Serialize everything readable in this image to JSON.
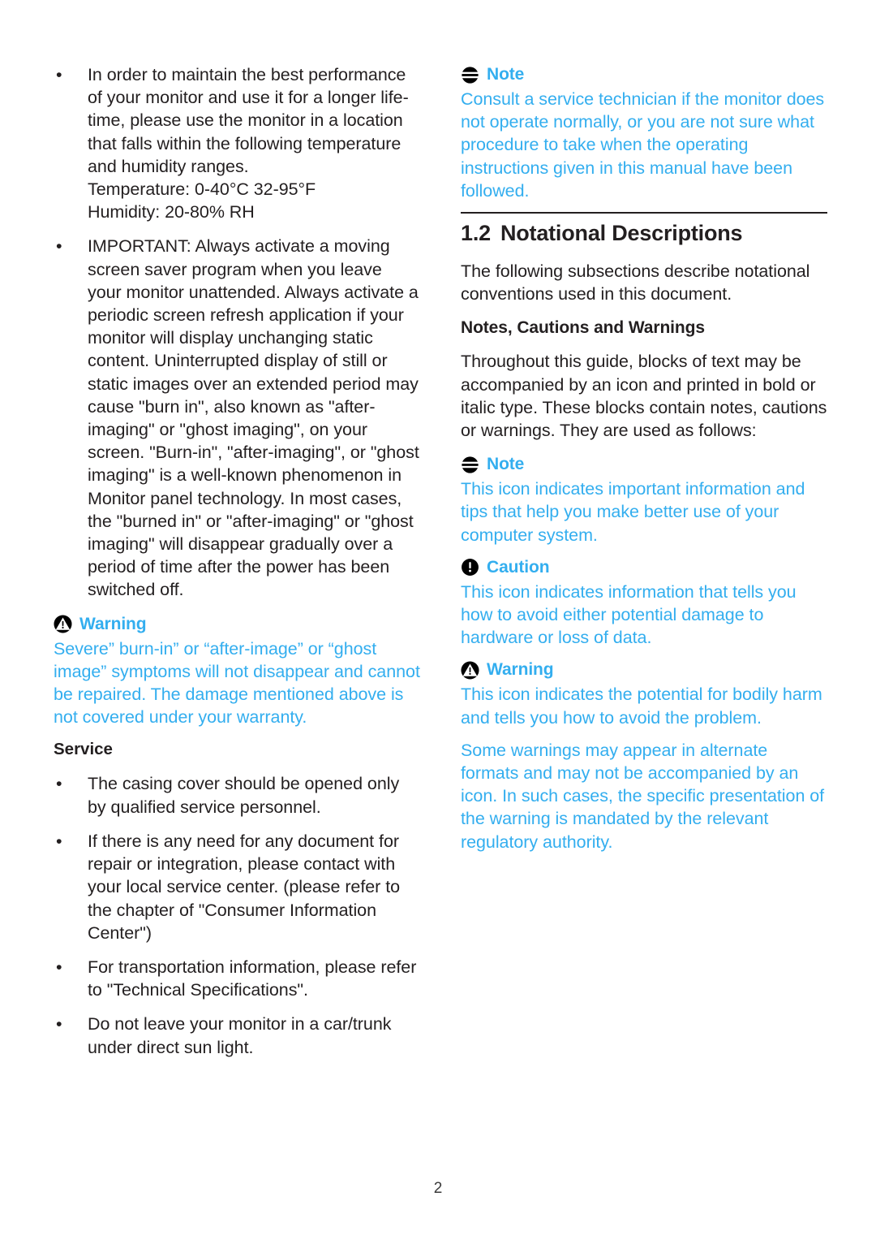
{
  "page": {
    "number": "2",
    "accent_color": "#33aeef",
    "text_color": "#231f20"
  },
  "left_column": {
    "bullets": [
      {
        "text": "In order to maintain the best performance of your monitor and use it for a longer life-time, please use the monitor in a location that falls within the following temperature and humidity ranges.",
        "line2": "Temperature: 0-40°C 32-95°F",
        "line3": "Humidity: 20-80% RH"
      },
      {
        "text": "IMPORTANT: Always activate a moving screen saver program when you leave your monitor unattended. Always activate a periodic screen refresh application if your monitor will display unchanging static content. Uninterrupted display of still or static images over an extended period may cause \"burn in\", also known as \"after-imaging\" or \"ghost imaging\", on your screen. \"Burn-in\", \"after-imaging\", or \"ghost imaging\" is a well-known phenomenon in Monitor panel technology. In most cases, the \"burned in\" or \"after-imaging\" or \"ghost imaging\" will disappear gradually over a period of time after the power has been switched off."
      }
    ],
    "warning": {
      "icon": "warning-triangle-icon",
      "title": "Warning",
      "body": "Severe” burn-in” or “after-image” or “ghost image” symptoms will not disappear and cannot be repaired. The damage mentioned above is not covered under your warranty."
    },
    "service": {
      "heading": "Service",
      "bullets": [
        "The casing cover should be opened only by qualified service personnel.",
        "If there is any need for any document for repair or integration, please contact with your local service center. (please refer to the chapter of \"Consumer Information Center\")",
        "For transportation information, please refer to \"Technical Specifications\".",
        "Do not leave your monitor in a car/trunk under direct sun light."
      ]
    }
  },
  "right_column": {
    "note_top": {
      "icon": "note-lines-icon",
      "title": "Note",
      "body": "Consult a service technician if the monitor does not operate normally, or you are not sure what procedure to take when the operating instructions given in this manual have been followed."
    },
    "section": {
      "number": "1.2",
      "title": "Notational Descriptions",
      "intro": "The following subsections describe notational conventions used in this document."
    },
    "subsection": {
      "heading": "Notes, Cautions and Warnings",
      "intro": "Throughout this guide, blocks of text may be accompanied by an icon and printed in bold or italic type. These blocks contain notes, cautions or warnings. They are used as follows:"
    },
    "note": {
      "icon": "note-lines-icon",
      "title": "Note",
      "body": "This icon indicates important information and tips that help you make better use of your computer system."
    },
    "caution": {
      "icon": "caution-exclamation-icon",
      "title": "Caution",
      "body": "This icon indicates information that tells you how to avoid either potential damage to hardware or loss of data."
    },
    "warning": {
      "icon": "warning-triangle-icon",
      "title": "Warning",
      "body": "This icon indicates the potential for bodily harm and tells you how to avoid the problem.",
      "body2": "Some warnings may appear in alternate formats and may not be accompanied by an icon. In such cases, the specific presentation of the warning is mandated by the relevant regulatory authority."
    }
  }
}
